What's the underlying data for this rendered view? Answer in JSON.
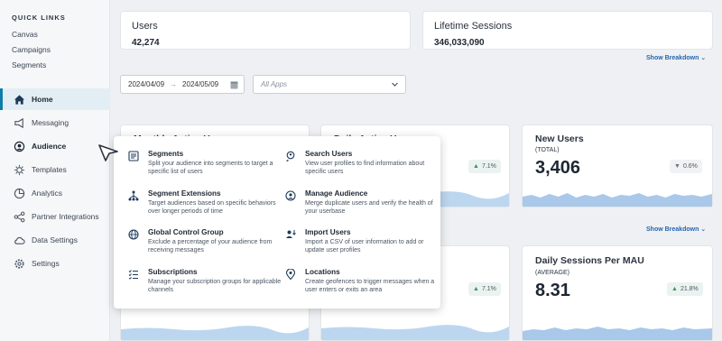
{
  "sidebar": {
    "quick_links_title": "QUICK LINKS",
    "quick_links": [
      "Canvas",
      "Campaigns",
      "Segments"
    ],
    "nav": [
      {
        "label": "Home",
        "icon": "home-icon"
      },
      {
        "label": "Messaging",
        "icon": "megaphone-icon"
      },
      {
        "label": "Audience",
        "icon": "audience-icon"
      },
      {
        "label": "Templates",
        "icon": "templates-icon"
      },
      {
        "label": "Analytics",
        "icon": "analytics-icon"
      },
      {
        "label": "Partner Integrations",
        "icon": "integrations-icon"
      },
      {
        "label": "Data Settings",
        "icon": "cloud-icon"
      },
      {
        "label": "Settings",
        "icon": "gear-icon"
      }
    ]
  },
  "stats": {
    "users": {
      "label": "Users",
      "value": "42,274"
    },
    "sessions": {
      "label": "Lifetime Sessions",
      "value": "346,033,090"
    }
  },
  "show_breakdown": "Show Breakdown",
  "filters": {
    "date_from": "2024/04/09",
    "date_to": "2024/05/09",
    "apps_placeholder": "All Apps"
  },
  "cards": {
    "mau_partial": "Monthly Active Users",
    "dau_partial": "Daily Active Users",
    "new_users": {
      "title": "New Users",
      "sub": "(TOTAL)",
      "value": "3,406",
      "change": "0.6%",
      "direction": "down"
    },
    "dau_change": "7.1%",
    "row2_change": "7.1%",
    "sessions_mau": {
      "title": "Daily Sessions Per MAU",
      "sub": "(AVERAGE)",
      "value": "8.31",
      "change": "21.8%",
      "direction": "up"
    }
  },
  "audience_menu": [
    {
      "title": "Segments",
      "desc": "Split your audience into segments to target a specific list of users",
      "icon": "segments-icon"
    },
    {
      "title": "Search Users",
      "desc": "View user profiles to find information about specific users",
      "icon": "search-user-icon"
    },
    {
      "title": "Segment Extensions",
      "desc": "Target audiences based on specific behaviors over longer periods of time",
      "icon": "hierarchy-icon"
    },
    {
      "title": "Manage Audience",
      "desc": "Merge duplicate users and verify the health of your userbase",
      "icon": "manage-audience-icon"
    },
    {
      "title": "Global Control Group",
      "desc": "Exclude a percentage of your audience from receiving messages",
      "icon": "globe-icon"
    },
    {
      "title": "Import Users",
      "desc": "Import a CSV of user information to add or update user profiles",
      "icon": "import-icon"
    },
    {
      "title": "Subscriptions",
      "desc": "Manage your subscription groups for applicable channels",
      "icon": "checklist-icon"
    },
    {
      "title": "Locations",
      "desc": "Create geofences to trigger messages when a user enters or exits an area",
      "icon": "location-pin-icon"
    }
  ],
  "colors": {
    "accent": "#0e7ea6",
    "link": "#2466b0",
    "spark": "#9ec2e6"
  }
}
